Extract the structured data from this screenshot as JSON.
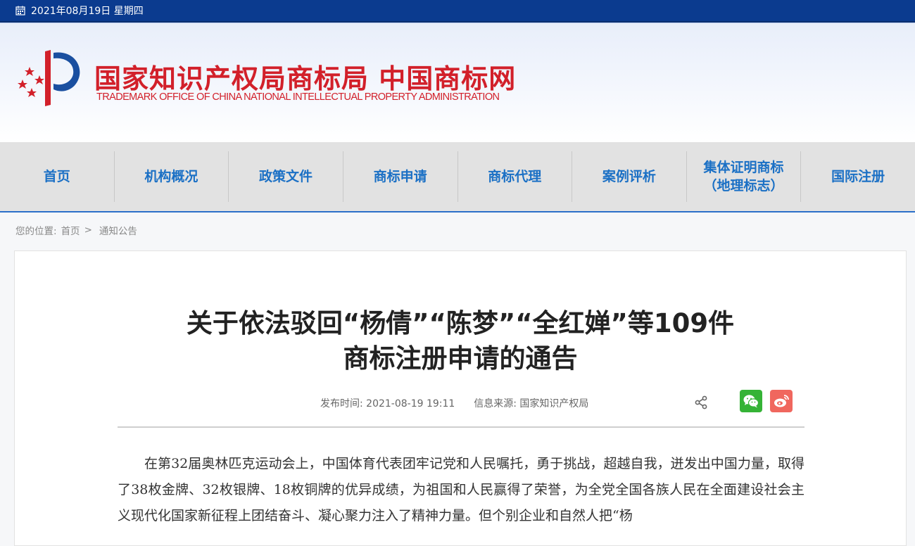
{
  "topbar": {
    "date": "2021年08月19日 星期四"
  },
  "header": {
    "logo_cn": "国家知识产权局商标局 中国商标网",
    "logo_en": "TRADEMARK OFFICE OF CHINA NATIONAL INTELLECTUAL PROPERTY ADMINISTRATION"
  },
  "nav": {
    "items": [
      {
        "label": "首页"
      },
      {
        "label": "机构概况"
      },
      {
        "label": "政策文件"
      },
      {
        "label": "商标申请"
      },
      {
        "label": "商标代理"
      },
      {
        "label": "案例评析"
      },
      {
        "label": "集体证明商标\n（地理标志）"
      },
      {
        "label": "国际注册"
      }
    ]
  },
  "breadcrumb": {
    "prefix": "您的位置:",
    "home": "首页",
    "separator": ">",
    "current": "通知公告"
  },
  "article": {
    "title_line1": "关于依法驳回“杨倩”“陈梦”“全红婵”等109件",
    "title_line2": "商标注册申请的通告",
    "publish_label": "发布时间:",
    "publish_time": "2021-08-19 19:11",
    "source_label": "信息来源:",
    "source": "国家知识产权局",
    "body": "在第32届奥林匹克运动会上，中国体育代表团牢记党和人民嘱托，勇于挑战，超越自我，迸发出中国力量，取得了38枚金牌、32枚银牌、18枚铜牌的优异成绩，为祖国和人民赢得了荣誉，为全党全国各族人民在全面建设社会主义现代化国家新征程上团结奋斗、凝心聚力注入了精神力量。但个别企业和自然人把“杨"
  },
  "colors": {
    "topbar": "#0b3b8f",
    "nav_text": "#1b70c5",
    "logo_red": "#d2202a",
    "wechat": "#35b336",
    "weibo": "#f0675e"
  }
}
